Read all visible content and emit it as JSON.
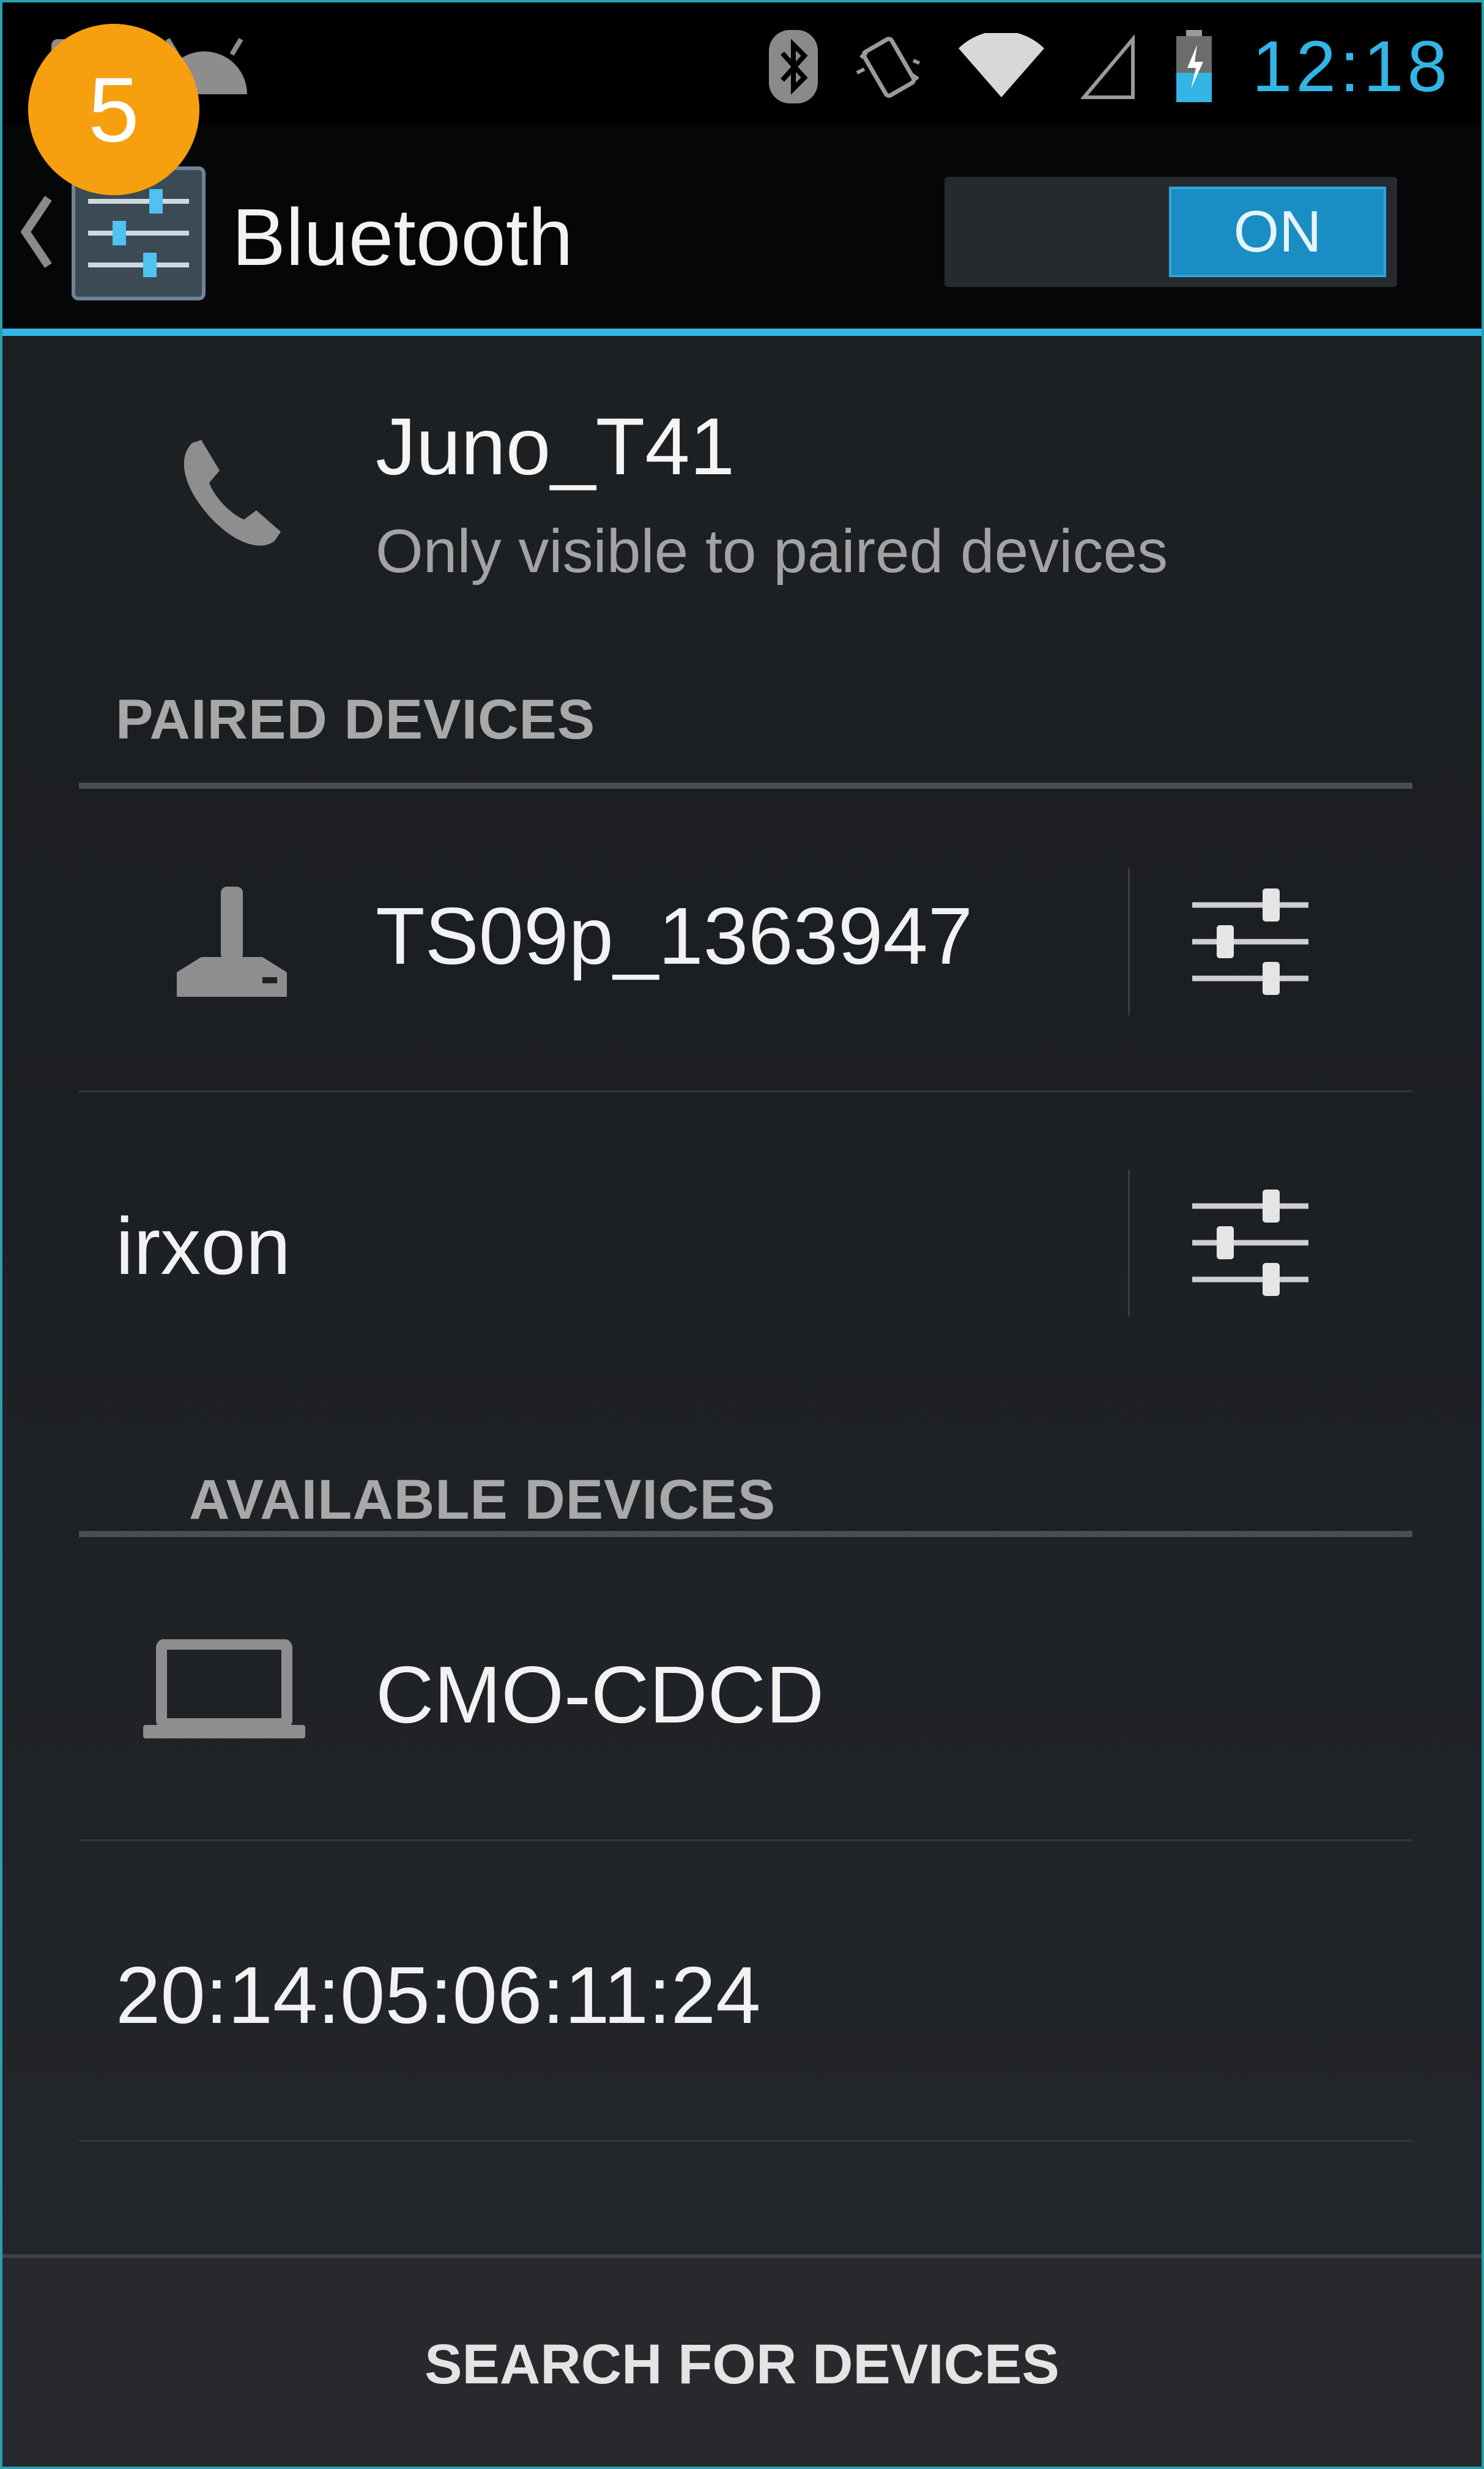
{
  "status_bar": {
    "time": "12:18",
    "icons": [
      "android-icon",
      "bluetooth-icon",
      "vibrate-icon",
      "wifi-icon",
      "cell-signal-icon",
      "battery-charging-icon"
    ]
  },
  "badge": {
    "number": "5",
    "color": "#f6a00f"
  },
  "action_bar": {
    "title": "Bluetooth",
    "toggle_label": "ON",
    "accent": "#33b5e5"
  },
  "this_device": {
    "icon": "phone-icon",
    "name": "Juno_T41",
    "visibility": "Only visible to paired devices"
  },
  "paired": {
    "header": "PAIRED DEVICES",
    "devices": [
      {
        "name": "TS09p_1363947",
        "icon": "joystick-icon"
      },
      {
        "name": "irxon",
        "icon": ""
      }
    ]
  },
  "available": {
    "header": "AVAILABLE DEVICES",
    "devices": [
      {
        "name": "CMO-CDCD",
        "icon": "laptop-icon"
      },
      {
        "name": "20:14:05:06:11:24",
        "icon": ""
      }
    ]
  },
  "footer": {
    "search_label": "SEARCH FOR DEVICES"
  }
}
